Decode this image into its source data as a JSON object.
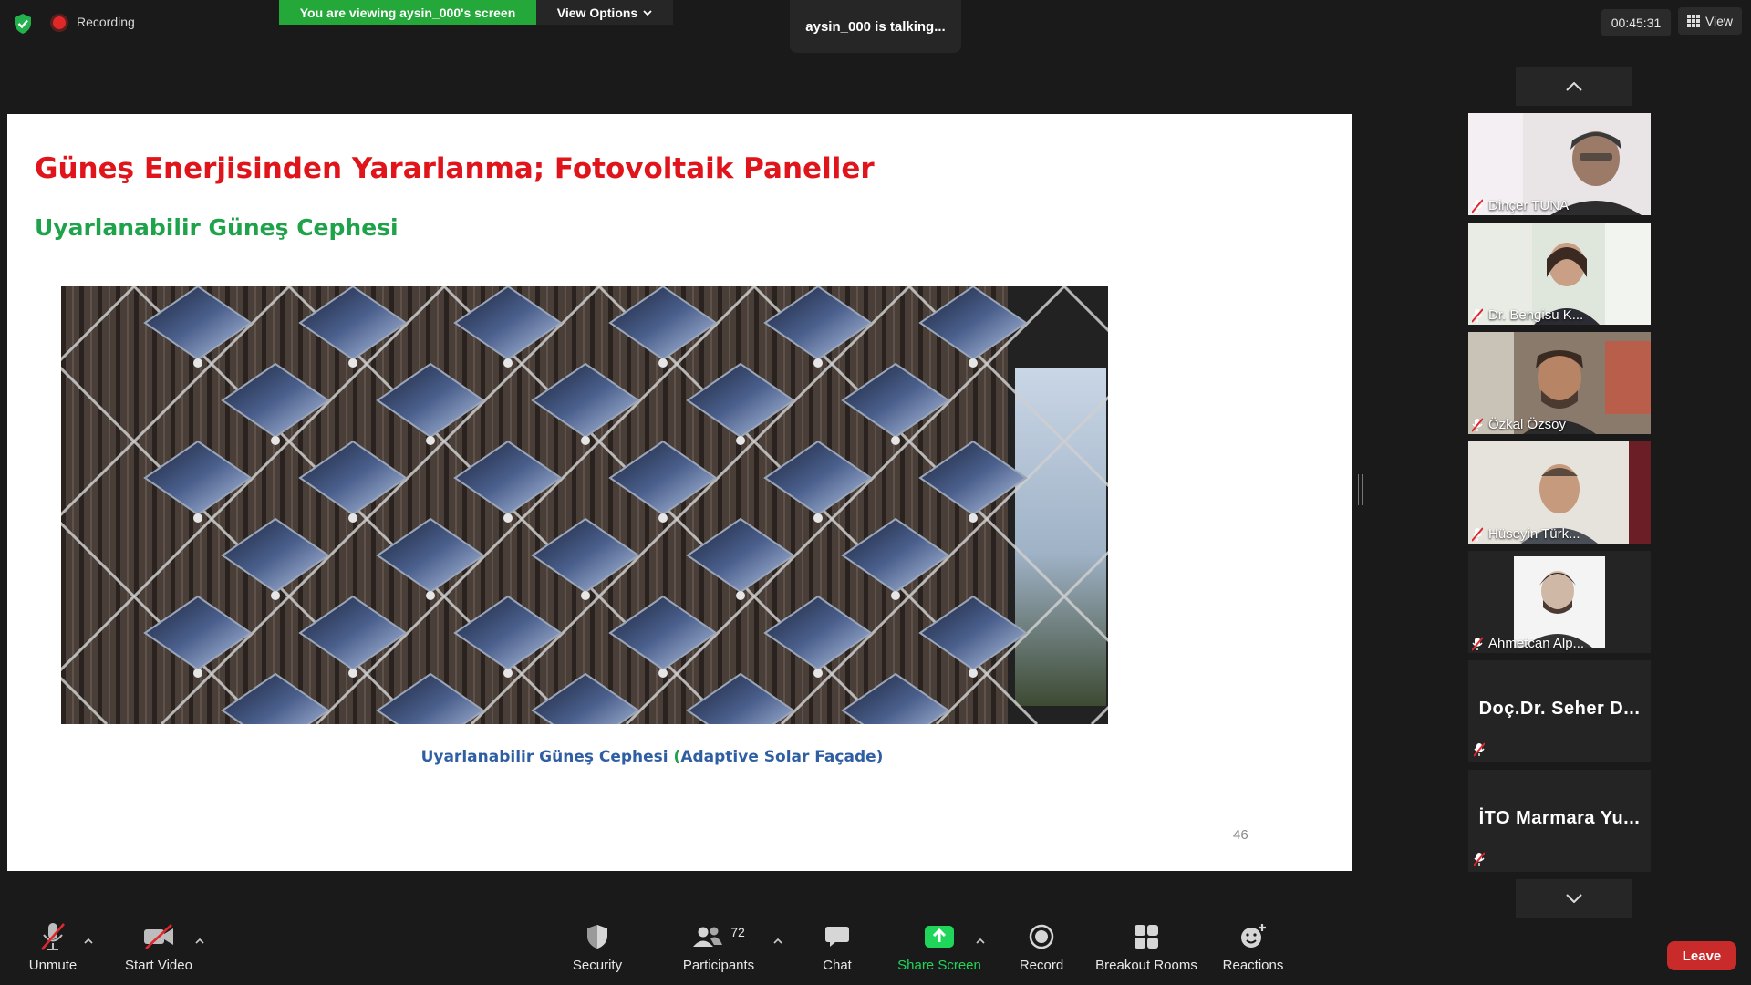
{
  "top_bar": {
    "recording_label": "Recording",
    "viewing_banner": "You are viewing aysin_000's screen",
    "view_options_label": "View Options",
    "talking_indicator": "aysin_000 is talking...",
    "timer": "00:45:31",
    "view_label": "View"
  },
  "slide": {
    "title": "Güneş Enerjisinden Yararlanma; Fotovoltaik Paneller",
    "subtitle": "Uyarlanabilir Güneş Cephesi",
    "caption_pre": "Uyarlanabilir Güneş Cephesi ",
    "caption_paren_open": "(",
    "caption_en": "Adaptive Solar Façade",
    "caption_paren_close": ")",
    "page_number": "46"
  },
  "gallery": {
    "participants": [
      {
        "name": "Dinçer TUNA",
        "muted": true,
        "video": true
      },
      {
        "name": "Dr. Bengisu K...",
        "muted": true,
        "video": true
      },
      {
        "name": "Özkal Özsoy",
        "muted": true,
        "video": true
      },
      {
        "name": "Hüseyin Türk...",
        "muted": true,
        "video": true
      },
      {
        "name": "Ahmetcan Alp...",
        "muted": true,
        "video": true
      },
      {
        "name": "Doç.Dr. Seher D...",
        "muted": true,
        "video": false
      },
      {
        "name": "İTO Marmara Yu...",
        "muted": true,
        "video": false
      }
    ]
  },
  "toolbar": {
    "unmute_label": "Unmute",
    "start_video_label": "Start Video",
    "security_label": "Security",
    "participants_label": "Participants",
    "participants_count": "72",
    "chat_label": "Chat",
    "share_screen_label": "Share Screen",
    "record_label": "Record",
    "breakout_rooms_label": "Breakout Rooms",
    "reactions_label": "Reactions",
    "leave_label": "Leave"
  },
  "colors": {
    "banner_green": "#25a83a",
    "share_green": "#1fd55a",
    "slide_title_red": "#e0141b",
    "slide_subtitle_green": "#1ea24a",
    "caption_blue": "#2f5fa2",
    "leave_red": "#c92b2b"
  },
  "icons": [
    "shield-check-icon",
    "recording-dot-icon",
    "chevron-down-icon",
    "grid-view-icon",
    "muted-mic-icon",
    "video-off-icon",
    "security-shield-icon",
    "participants-icon",
    "chat-icon",
    "share-screen-icon",
    "record-icon",
    "breakout-rooms-icon",
    "reactions-icon",
    "caret-up-icon",
    "chevron-up-icon"
  ]
}
